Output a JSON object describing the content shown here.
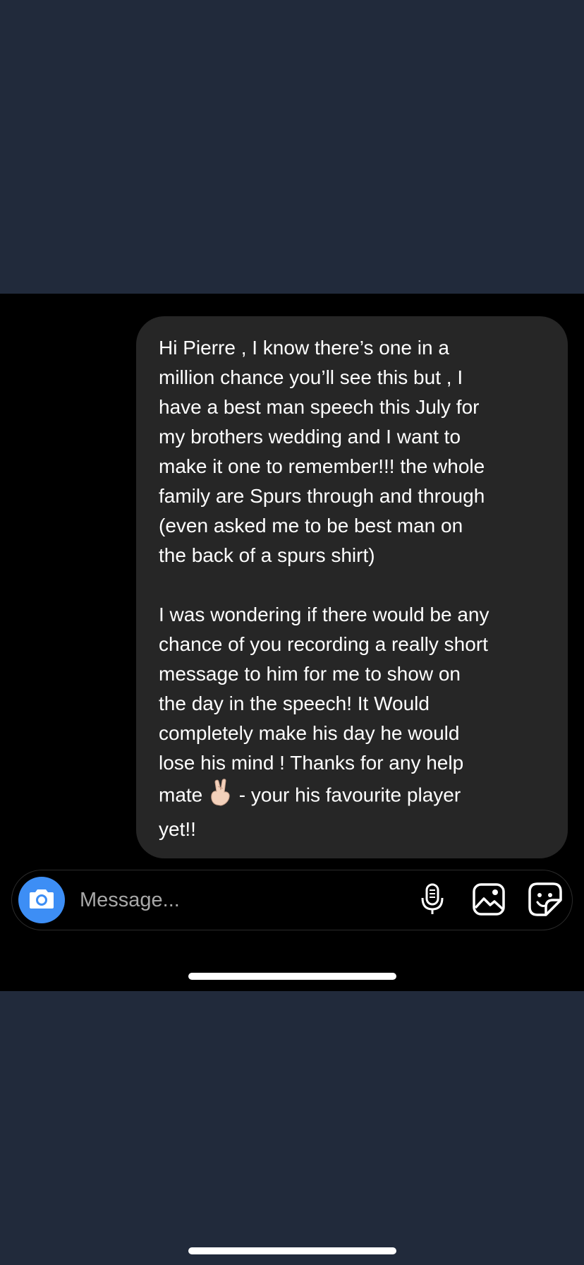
{
  "conversation": {
    "message_paragraph_1": "Hi Pierre , I know there’s one in a\nmillion chance you’ll see this but , I\nhave a best man speech this July for\nmy brothers wedding and I want to\nmake it one to remember!!! the whole\nfamily are Spurs through and through\n(even asked me to be best man on\nthe back of a spurs shirt)",
    "message_paragraph_2_start": "I was wondering if there would be any\nchance of you recording a really short\nmessage to him for me to show on\nthe day in the speech! It Would\ncompletely make his day he would\nlose his mind ! Thanks for any help\nmate",
    "message_emoji_icon": "crossed-fingers-icon",
    "message_paragraph_2_end": " - your his  favourite player\nyet!!"
  },
  "composer": {
    "placeholder": "Message...",
    "camera_icon": "camera-icon",
    "mic_icon": "microphone-icon",
    "gallery_icon": "image-icon",
    "sticker_icon": "sticker-icon",
    "accent_color": "#3d8ef5"
  }
}
